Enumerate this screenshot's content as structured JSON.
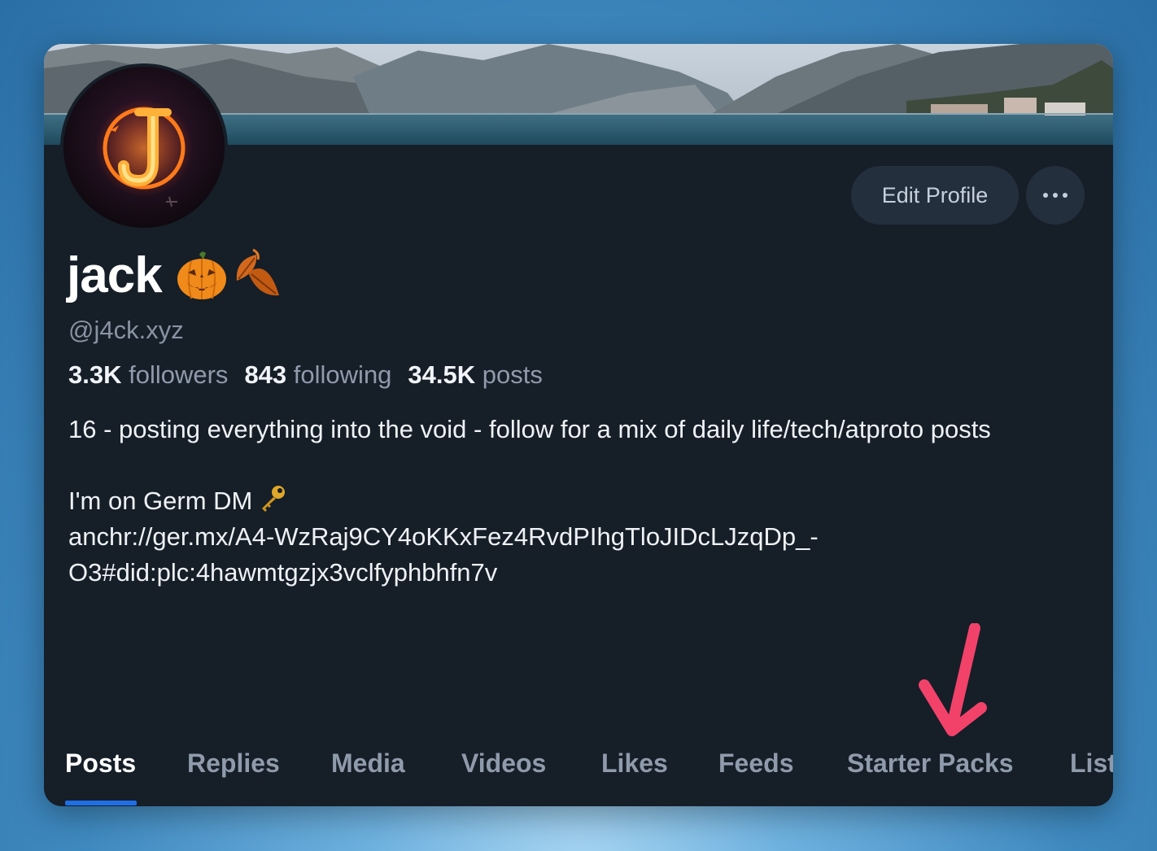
{
  "profile": {
    "display_name": "jack",
    "handle": "@j4ck.xyz",
    "name_emojis": [
      "jack-o-lantern",
      "fallen-leaf"
    ]
  },
  "stats": {
    "followers_count": "3.3K",
    "followers_label": "followers",
    "following_count": "843",
    "following_label": "following",
    "posts_count": "34.5K",
    "posts_label": "posts"
  },
  "bio": {
    "line1": "16 - posting everything into the void - follow for a mix of daily life/tech/atproto posts",
    "line2": "I'm on Germ DM",
    "line2_icon": "key-icon",
    "line3": "anchr://ger.mx/A4-WzRaj9CY4oKKxFez4RvdPIhgTloJIDcLJzqDp_-",
    "line4": "O3#did:plc:4hawmtgzjx3vclfyphbhfn7v"
  },
  "buttons": {
    "edit_profile": "Edit Profile",
    "more": "more-options-icon"
  },
  "tabs": [
    {
      "label": "Posts",
      "active": true
    },
    {
      "label": "Replies",
      "active": false
    },
    {
      "label": "Media",
      "active": false
    },
    {
      "label": "Videos",
      "active": false
    },
    {
      "label": "Likes",
      "active": false
    },
    {
      "label": "Feeds",
      "active": false
    },
    {
      "label": "Starter Packs",
      "active": false
    },
    {
      "label": "Lists",
      "active": false
    }
  ],
  "colors": {
    "background": "#161e28",
    "accent": "#1f6fe8",
    "arrow": "#f2426a",
    "button_bg": "#242f3e"
  }
}
